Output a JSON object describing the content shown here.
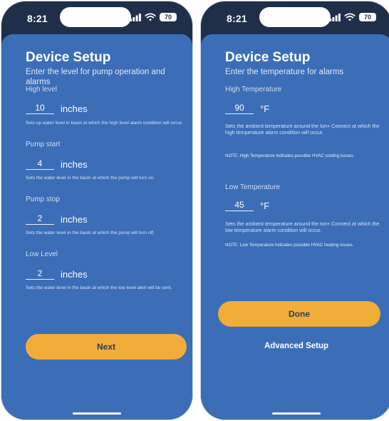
{
  "status_bar": {
    "time": "8:21",
    "battery": "70"
  },
  "left_screen": {
    "title": "Device Setup",
    "subtitle": "Enter the level for pump operation and alarms",
    "fields": [
      {
        "label": "High level",
        "value": "10",
        "unit": "inches",
        "help": "Sets up water level in basin at which the high level alarm condition will occur."
      },
      {
        "label": "Pump start",
        "value": "4",
        "unit": "inches",
        "help": "Sets the water level in the basin at which the pump will turn on."
      },
      {
        "label": "Pump stop",
        "value": "2",
        "unit": "inches",
        "help": "Sets the water level in the basin at which the pump will turn off."
      },
      {
        "label": "Low Level",
        "value": "2",
        "unit": "inches",
        "help": "Sets the water level in the basin at which the low level alert will be sent."
      }
    ],
    "next_label": "Next"
  },
  "right_screen": {
    "title": "Device Setup",
    "subtitle": "Enter the temperature for alarms",
    "fields": [
      {
        "label": "High Temperature",
        "value": "90",
        "unit": "°F",
        "help": "Sets the ambient temperature around the Ion+ Connect at which the high temperature alarm condition will occur.",
        "note": "NOTE: High Temperature indicates possible HVAC cooling issues."
      },
      {
        "label": "Low Temperature",
        "value": "45",
        "unit": "°F",
        "help": "Sets the ambient temperature around the Ion+ Connect at which the low temperature alarm condition will occur.",
        "note": "NOTE: Low Temperature indicates possible HVAC heating issues."
      }
    ],
    "done_label": "Done",
    "advanced_label": "Advanced Setup"
  },
  "colors": {
    "screen_bg": "#3b6eb7",
    "accent_button": "#f1ad3a",
    "phone_frame": "#1f2f4a"
  }
}
